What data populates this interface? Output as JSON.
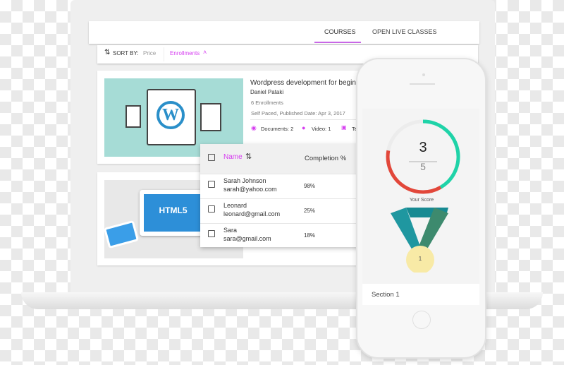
{
  "tabs": {
    "courses": "COURSES",
    "live": "OPEN LIVE CLASSES"
  },
  "sort": {
    "label": "SORT BY:",
    "price": "Price",
    "enrollments": "Enrollments"
  },
  "course": {
    "title": "Wordpress development for beginners",
    "author": "Daniel Pataki",
    "enrollments": "6 Enrollments",
    "meta": "Self Paced, Published Date: Apr 3, 2017",
    "documents": "Documents: 2",
    "video": "Video: 1",
    "text": "Te",
    "image_text": "W"
  },
  "course2": {
    "image_text": "HTML5"
  },
  "table": {
    "name_header": "Name",
    "completion_header": "Completion %",
    "rows": [
      {
        "name": "Sarah Johnson",
        "email": "sarah@yahoo.com",
        "completion": "98%"
      },
      {
        "name": "Leonard",
        "email": "leonard@gmail.com",
        "completion": "25%"
      },
      {
        "name": "Sara",
        "email": "sara@gmail.com",
        "completion": "18%"
      }
    ]
  },
  "score": {
    "value": "3",
    "total": "5",
    "label": "Your Score",
    "medal": "1",
    "section": "Section 1"
  },
  "colors": {
    "accent": "#d63ef0",
    "teal": "#1fd3a8",
    "red": "#e2473a",
    "thumb1": "#a6dcd6"
  }
}
